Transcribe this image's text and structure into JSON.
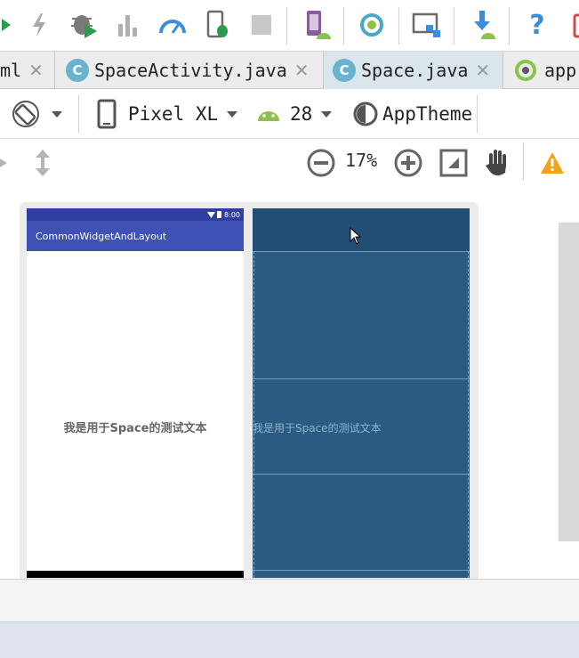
{
  "toolbar": {
    "icons": [
      "run-icon",
      "apply-changes-icon",
      "debug-icon",
      "profile-icon",
      "attach-debugger-icon",
      "stop-icon",
      "avd-manager-icon",
      "sync-icon",
      "project-structure-icon",
      "sdk-manager-icon",
      "help-icon"
    ],
    "accent_colors": {
      "run": "#2e9a4f",
      "android": "#8bc34a",
      "blue": "#3d8ed9",
      "red": "#d24b4b",
      "purple": "#8a5aa0"
    }
  },
  "tabs": [
    {
      "label": "ml",
      "closable": true
    },
    {
      "label": "SpaceActivity.java",
      "icon": "C",
      "closable": true
    },
    {
      "label": "Space.java",
      "icon": "C",
      "closable": true,
      "active": true
    },
    {
      "label": "app",
      "icon": "app-module-icon"
    }
  ],
  "device_toolbar": {
    "orientation_icon": "rotate-icon",
    "device": "Pixel XL",
    "api_level": "28",
    "theme": "AppTheme"
  },
  "zoom_toolbar": {
    "zoom_level": "17%",
    "warning_icon": "warning-icon"
  },
  "preview": {
    "status_time": "8:00",
    "app_title": "CommonWidgetAndLayout",
    "center_text": "我是用于Space的测试文本",
    "blueprint_text": "我是用于Space的测试文本"
  }
}
